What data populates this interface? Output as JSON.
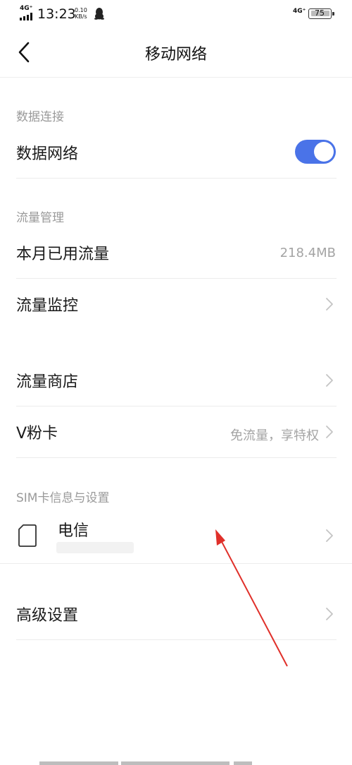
{
  "status_bar": {
    "network_left": "4G⁺",
    "time": "13:23",
    "speed_value": "0.10",
    "speed_unit": "KB/s",
    "network_right": "4G⁺",
    "battery": "75"
  },
  "header": {
    "title": "移动网络"
  },
  "sections": {
    "data_connection": {
      "label": "数据连接",
      "data_network_label": "数据网络",
      "data_network_enabled": true
    },
    "traffic": {
      "label": "流量管理",
      "monthly_usage_label": "本月已用流量",
      "monthly_usage_value": "218.4MB",
      "monitor_label": "流量监控"
    },
    "store": {
      "store_label": "流量商店",
      "vcard_label": "V粉卡",
      "vcard_value": "免流量，享特权"
    },
    "sim": {
      "label": "SIM卡信息与设置",
      "carrier_name": "电信"
    },
    "advanced": {
      "label": "高级设置"
    }
  },
  "colors": {
    "toggle_on": "#4a73e8",
    "annotation_arrow": "#e0302a"
  },
  "icons": {
    "back": "chevron-left-icon",
    "row_arrow": "chevron-right-icon",
    "sim": "sim-card-icon",
    "qq": "qq-penguin-icon"
  }
}
